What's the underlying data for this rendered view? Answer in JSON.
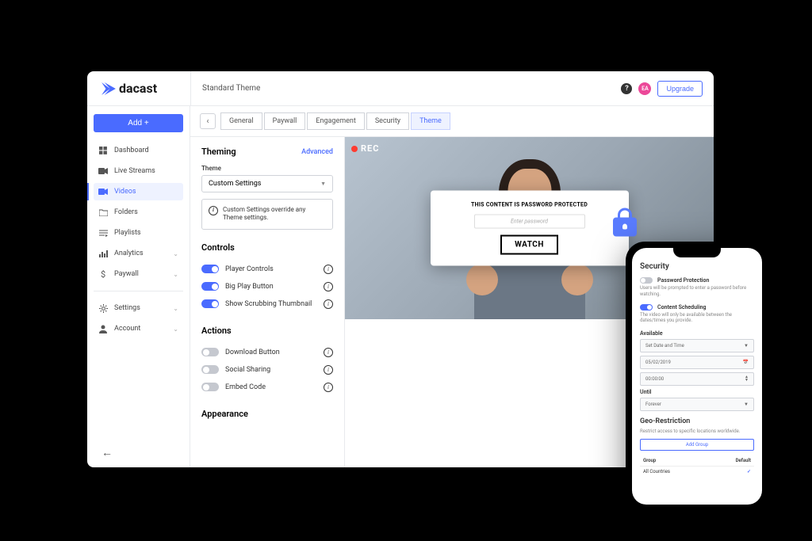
{
  "logo": "dacast",
  "header": {
    "title": "Standard Theme",
    "avatar": "EA",
    "upgrade": "Upgrade"
  },
  "sidebar": {
    "add": "Add +",
    "items": [
      {
        "label": "Dashboard"
      },
      {
        "label": "Live Streams"
      },
      {
        "label": "Videos"
      },
      {
        "label": "Folders"
      },
      {
        "label": "Playlists"
      },
      {
        "label": "Analytics"
      },
      {
        "label": "Paywall"
      }
    ],
    "settings": "Settings",
    "account": "Account"
  },
  "tabs": {
    "general": "General",
    "paywall": "Paywall",
    "engagement": "Engagement",
    "security": "Security",
    "theme": "Theme"
  },
  "theming": {
    "title": "Theming",
    "advanced": "Advanced",
    "theme_label": "Theme",
    "theme_value": "Custom Settings",
    "info": "Custom Settings override any Theme settings."
  },
  "controls": {
    "title": "Controls",
    "player": "Player Controls",
    "big_play": "Big Play Button",
    "scrubbing": "Show Scrubbing Thumbnail"
  },
  "actions": {
    "title": "Actions",
    "download": "Download Button",
    "social": "Social Sharing",
    "embed": "Embed Code"
  },
  "appearance": {
    "title": "Appearance"
  },
  "player": {
    "rec": "REC",
    "protected": "THIS CONTENT IS PASSWORD PROTECTED",
    "placeholder": "Enter password",
    "watch": "WATCH"
  },
  "phone": {
    "title": "Security",
    "pw_protection": "Password Protection",
    "pw_desc": "Users will be prompted to enter a password before watching.",
    "scheduling": "Content Scheduling",
    "sched_desc": "The video will only be available between the dates/times you provide.",
    "available": "Available",
    "set_date": "Set Date and Time",
    "date_val": "05/02/2019",
    "time_val": "00:00:00",
    "until": "Until",
    "forever": "Forever",
    "geo_title": "Geo-Restriction",
    "geo_desc": "Restrict access to specific locations worldwide.",
    "add_group": "Add Group",
    "col_group": "Group",
    "col_default": "Default",
    "all_countries": "All Countries"
  }
}
